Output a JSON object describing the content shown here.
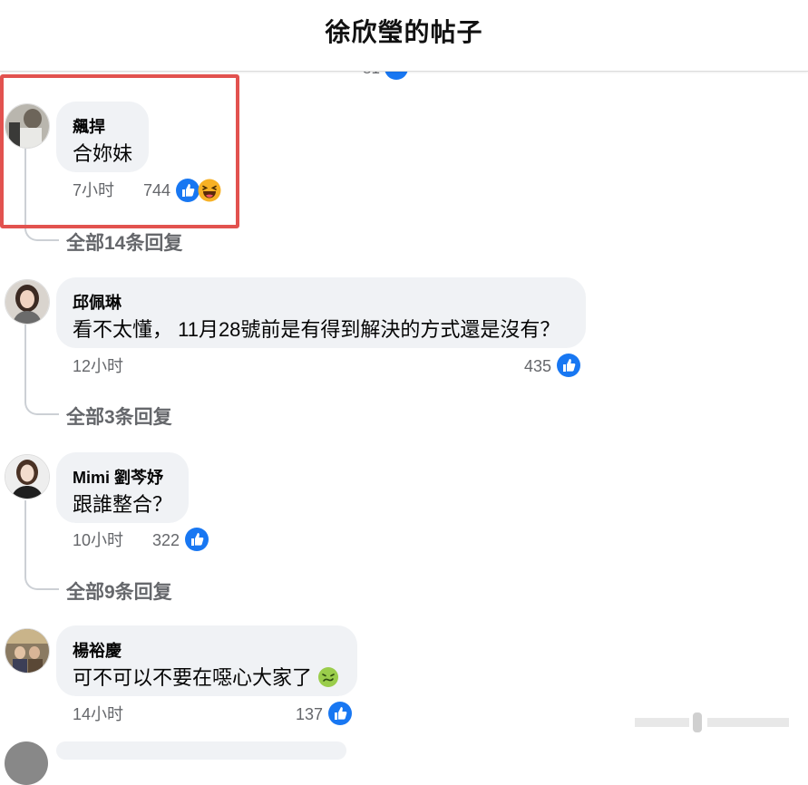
{
  "header": {
    "title": "徐欣瑩的帖子"
  },
  "partial_above": {
    "text_left": "",
    "likes": "81"
  },
  "comments": [
    {
      "author": "飆捍",
      "text": "合妳妹",
      "time": "7小时",
      "likes": "744",
      "reactions": [
        "like-icon",
        "haha-icon"
      ],
      "replies": "全部14条回复"
    },
    {
      "author": "邱佩琳",
      "text": "看不太懂， 11月28號前是有得到解決的方式還是沒有？",
      "time": "12小时",
      "likes": "435",
      "reactions": [
        "like-icon"
      ],
      "replies": "全部3条回复"
    },
    {
      "author": "Mimi 劉芩妤",
      "text": "跟誰整合？",
      "time": "10小时",
      "likes": "322",
      "reactions": [
        "like-icon"
      ],
      "replies": "全部9条回复"
    },
    {
      "author": "楊裕慶",
      "text": "可不可以不要在噁心大家了",
      "time": "14小时",
      "likes": "137",
      "reactions": [
        "like-icon"
      ],
      "emoji": "nauseated-face-icon"
    }
  ],
  "colors": {
    "like": "#1877f2",
    "bubble": "#f0f2f5",
    "highlight": "#e2524f",
    "secondary_text": "#65676b"
  }
}
